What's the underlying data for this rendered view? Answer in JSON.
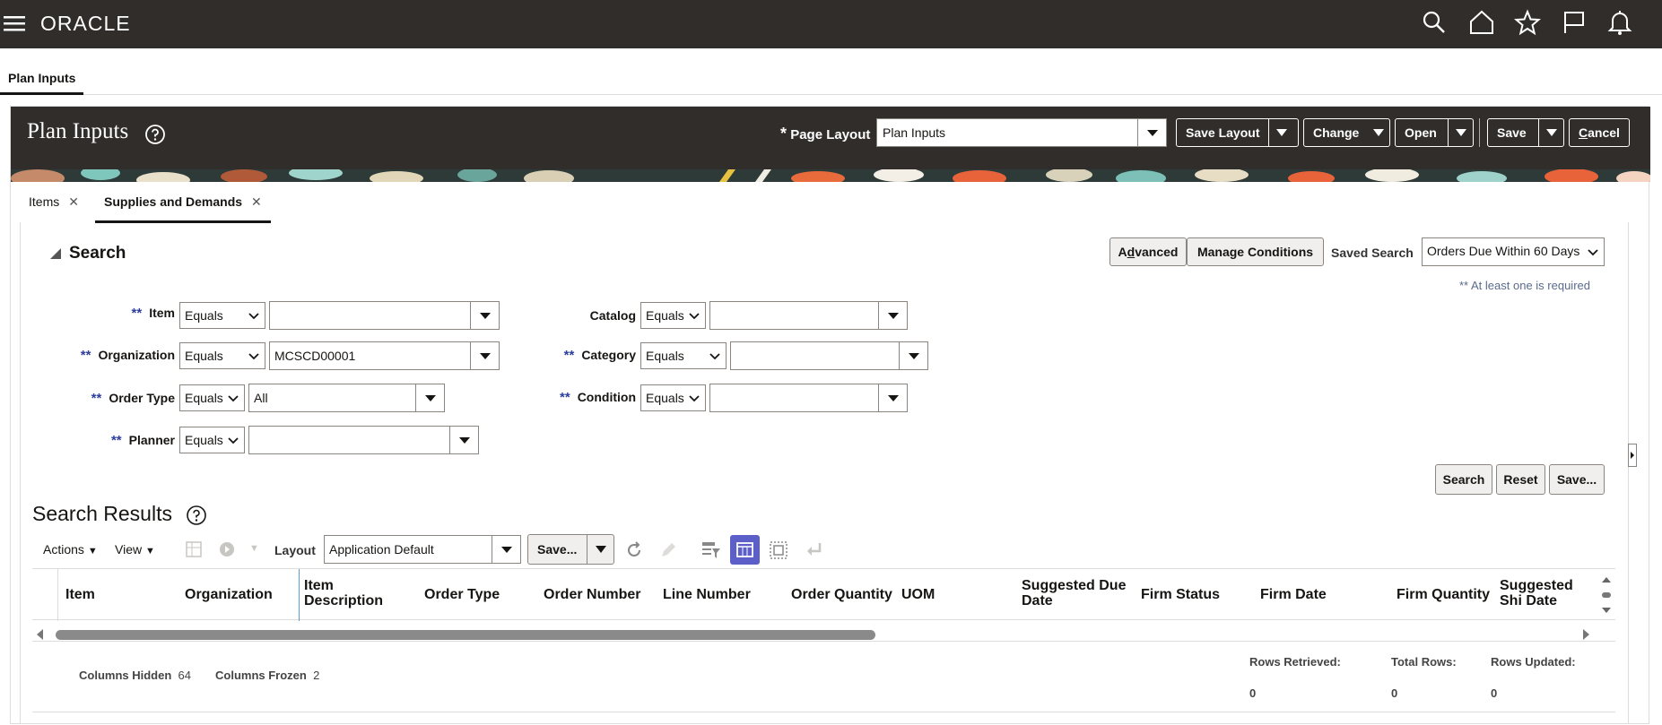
{
  "app": {
    "brand": "ORACLE"
  },
  "page_tab": {
    "label": "Plan Inputs"
  },
  "header": {
    "title": "Plan Inputs",
    "page_layout_label": "Page Layout",
    "page_layout_required": "*",
    "page_layout_value": "Plan Inputs",
    "save_layout": "Save Layout",
    "change": "Change",
    "open": "Open",
    "save": "Save",
    "cancel_prefix": "C",
    "cancel_rest": "ancel"
  },
  "subtabs": [
    {
      "label": "Items"
    },
    {
      "label": "Supplies and Demands"
    }
  ],
  "search": {
    "title": "Search",
    "advanced_prefix": "A",
    "advanced_u": "d",
    "advanced_rest": "vanced",
    "manage_conditions": "Manage Conditions",
    "saved_search_label": "Saved Search",
    "saved_search_value": "Orders Due Within 60 Days",
    "required_note": "** At least one is required",
    "req_mark": "**",
    "fields": {
      "item": {
        "label": "Item",
        "operator": "Equals",
        "value": ""
      },
      "organization": {
        "label": "Organization",
        "operator": "Equals",
        "value": "MCSCD00001"
      },
      "order_type": {
        "label": "Order Type",
        "operator": "Equals",
        "value": "All"
      },
      "planner": {
        "label": "Planner",
        "operator": "Equals",
        "value": ""
      },
      "catalog": {
        "label": "Catalog",
        "operator": "Equals",
        "value": ""
      },
      "category": {
        "label": "Category",
        "operator": "Equals",
        "value": ""
      },
      "condition": {
        "label": "Condition",
        "operator": "Equals",
        "value": ""
      }
    },
    "buttons": {
      "search": "Search",
      "reset": "Reset",
      "save": "Save..."
    }
  },
  "results": {
    "title": "Search Results",
    "actions": "Actions",
    "view": "View",
    "layout_label": "Layout",
    "layout_value": "Application Default",
    "save": "Save...",
    "columns": [
      "Item",
      "Organization",
      "Item Description",
      "Order Type",
      "Order Number",
      "Line Number",
      "Order Quantity",
      "UOM",
      "Suggested Due Date",
      "Firm Status",
      "Firm Date",
      "Firm Quantity",
      "Suggested Shi Date"
    ],
    "columns_hidden_label": "Columns Hidden",
    "columns_hidden": "64",
    "columns_frozen_label": "Columns Frozen",
    "columns_frozen": "2",
    "rows_retrieved_label": "Rows Retrieved:",
    "rows_retrieved": "0",
    "total_rows_label": "Total Rows:",
    "total_rows": "0",
    "rows_updated_label": "Rows Updated:",
    "rows_updated": "0"
  },
  "colors": {
    "header_bg": "#312d2a",
    "accent": "#5b5fc7",
    "required": "#2c3e9e"
  }
}
